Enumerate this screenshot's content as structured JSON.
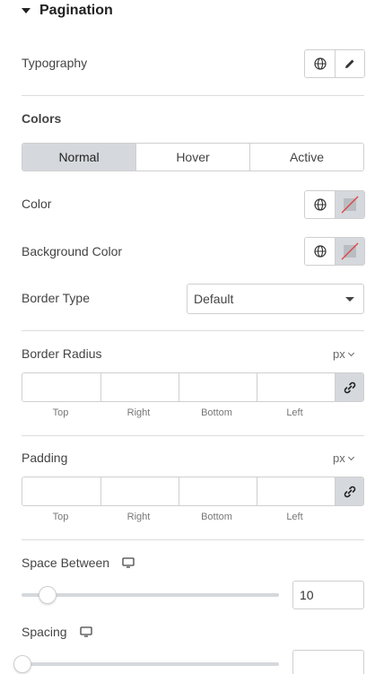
{
  "section": {
    "title": "Pagination"
  },
  "typography": {
    "label": "Typography"
  },
  "colors": {
    "heading": "Colors",
    "tabs": [
      {
        "label": "Normal",
        "active": true
      },
      {
        "label": "Hover",
        "active": false
      },
      {
        "label": "Active",
        "active": false
      }
    ],
    "color_label": "Color",
    "background_color_label": "Background Color"
  },
  "border_type": {
    "label": "Border Type",
    "value": "Default"
  },
  "border_radius": {
    "label": "Border Radius",
    "unit": "px",
    "fields": [
      "Top",
      "Right",
      "Bottom",
      "Left"
    ]
  },
  "padding": {
    "label": "Padding",
    "unit": "px",
    "fields": [
      "Top",
      "Right",
      "Bottom",
      "Left"
    ]
  },
  "space_between": {
    "label": "Space Between",
    "value": "10"
  },
  "spacing": {
    "label": "Spacing",
    "value": ""
  },
  "theme": {
    "active_bg": "#d5d8dc",
    "border": "#cfcfcf",
    "swatch_slash": "#e0413f"
  }
}
